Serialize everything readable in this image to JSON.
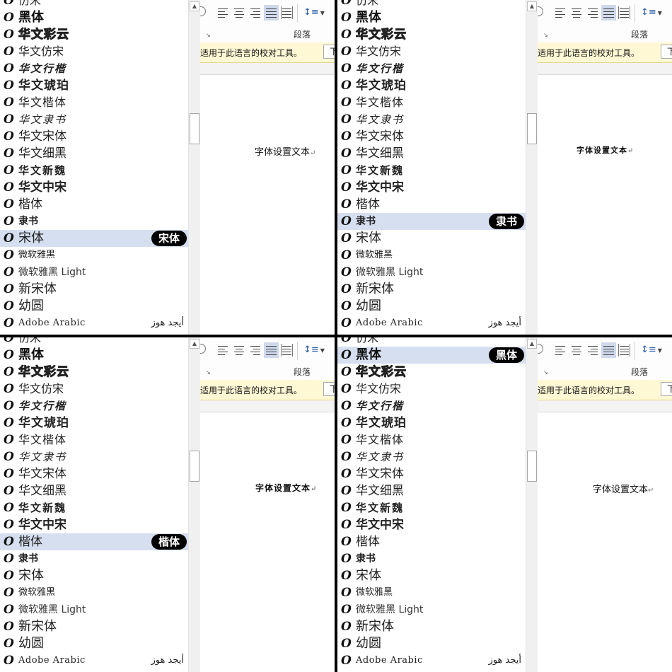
{
  "font_list": [
    {
      "name": "仿宋",
      "style": "f-fs"
    },
    {
      "name": "黑体",
      "style": "f-hei"
    },
    {
      "name": "华文彩云",
      "style": "f-caiyun"
    },
    {
      "name": "华文仿宋",
      "style": "f-fs"
    },
    {
      "name": "华文行楷",
      "style": "f-xk"
    },
    {
      "name": "华文琥珀",
      "style": "f-hp"
    },
    {
      "name": "华文楷体",
      "style": "f-kai"
    },
    {
      "name": "华文隶书",
      "style": "f-ls"
    },
    {
      "name": "华文宋体",
      "style": "f-song"
    },
    {
      "name": "华文细黑",
      "style": "f-xh"
    },
    {
      "name": "华文新魏",
      "style": "f-xw"
    },
    {
      "name": "华文中宋",
      "style": "f-zs"
    },
    {
      "name": "楷体",
      "style": "f-kt"
    },
    {
      "name": "隶书",
      "style": "f-lishu"
    },
    {
      "name": "宋体",
      "style": "f-simsun"
    },
    {
      "name": "微软雅黑",
      "style": "f-yh"
    },
    {
      "name": "微软雅黑 Light",
      "style": "f-yhl"
    },
    {
      "name": "新宋体",
      "style": "f-nsong"
    },
    {
      "name": "幼圆",
      "style": "f-yy"
    },
    {
      "name": "Adobe Arabic",
      "style": "f-arabic",
      "sample": "أيجد هوز"
    }
  ],
  "panels": [
    {
      "selected_font": "宋体",
      "selected_index": 14,
      "doc_style": "t-songti"
    },
    {
      "selected_font": "隶书",
      "selected_index": 13,
      "doc_style": "t-lishu"
    },
    {
      "selected_font": "楷体",
      "selected_index": 12,
      "doc_style": "t-kaiti"
    },
    {
      "selected_font": "黑体",
      "selected_index": 1,
      "doc_style": "t-heiti"
    }
  ],
  "ribbon": {
    "group_label": "段落",
    "launcher_glyph": "↘"
  },
  "infobar": {
    "message": "适用于此语言的校对工具。",
    "button_label": "下"
  },
  "document": {
    "text": "字体设置文本",
    "paragraph_mark": "↵"
  },
  "icons": {
    "font_type": "opentype-font-icon",
    "scroll_up": "scroll-up-arrow-icon"
  }
}
